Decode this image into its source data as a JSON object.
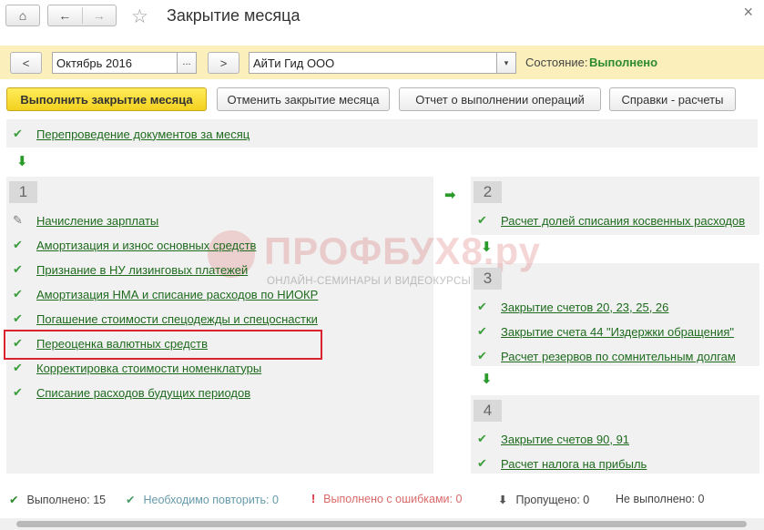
{
  "window": {
    "title": "Закрытие месяца",
    "home_icon": "home-icon",
    "back_icon": "arrow-left-icon",
    "forward_icon": "arrow-right-icon",
    "favorite_icon": "star-icon",
    "close_icon": "close-icon",
    "home_glyph": "⌂",
    "back_glyph": "←",
    "forward_glyph": "→",
    "star_glyph": "☆",
    "close_glyph": "×"
  },
  "filters": {
    "prev_label": "<",
    "next_label": ">",
    "period_value": "Октябрь 2016",
    "period_picker_label": "...",
    "organization_value": "АйТи Гид ООО",
    "organization_dropdown_glyph": "▾",
    "status_label": "Состояние:",
    "status_value": "Выполнено",
    "status_color": "#2d8a2d"
  },
  "toolbar": {
    "execute_label": "Выполнить закрытие месяца",
    "cancel_label": "Отменить закрытие месяца",
    "report_label": "Отчет о выполнении операций",
    "references_label": "Справки - расчеты",
    "primary_color": "#f3d11f"
  },
  "top_operation": {
    "check_glyph": "✔",
    "label": "Перепроведение документов за месяц"
  },
  "arrows": {
    "down_glyph": "⬇",
    "right_glyph": "➡"
  },
  "group1": {
    "number": "1",
    "items": [
      {
        "label": "Начисление зарплаты",
        "check": "✎"
      },
      {
        "label": "Амортизация и износ основных средств",
        "check": "✔"
      },
      {
        "label": "Признание в НУ лизинговых платежей",
        "check": "✔"
      },
      {
        "label": "Амортизация НМА и списание расходов по НИОКР",
        "check": "✔"
      },
      {
        "label": "Погашение стоимости спецодежды и спецоснастки",
        "check": "✔"
      },
      {
        "label": "Переоценка валютных средств",
        "check": "✔"
      },
      {
        "label": "Корректировка стоимости номенклатуры",
        "check": "✔"
      },
      {
        "label": "Списание расходов будущих периодов",
        "check": "✔"
      }
    ]
  },
  "group2": {
    "number": "2",
    "items": [
      {
        "label": "Расчет долей списания косвенных расходов",
        "check": "✔"
      }
    ]
  },
  "group3": {
    "number": "3",
    "items": [
      {
        "label": "Закрытие счетов 20, 23, 25, 26",
        "check": "✔"
      },
      {
        "label": "Закрытие счета 44 \"Издержки обращения\"",
        "check": "✔"
      },
      {
        "label": "Расчет резервов по сомнительным долгам",
        "check": "✔"
      }
    ]
  },
  "group4": {
    "number": "4",
    "items": [
      {
        "label": "Закрытие счетов 90, 91",
        "check": "✔"
      },
      {
        "label": "Расчет налога на прибыль",
        "check": "✔"
      }
    ]
  },
  "watermark": {
    "title": "ПРОФБУХ8.ру",
    "subtitle": "ОНЛАЙН-СЕМИНАРЫ И ВИДЕОКУРСЫ 1С:8"
  },
  "footer": {
    "done": {
      "icon": "✔",
      "text": "Выполнено: 15"
    },
    "repeat": {
      "icon": "✔",
      "text": "Необходимо повторить: 0"
    },
    "errors": {
      "icon": "!",
      "text": "Выполнено с ошибками: 0"
    },
    "skipped": {
      "icon": "⬇",
      "text": "Пропущено: 0"
    },
    "not_done": {
      "text": "Не выполнено: 0"
    }
  }
}
